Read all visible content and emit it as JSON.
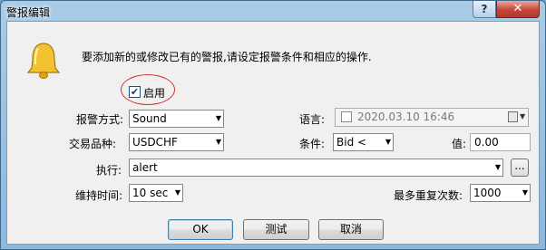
{
  "window": {
    "title": "警报编辑",
    "help_label": "?",
    "close_label": "✕"
  },
  "icons": {
    "bell": "bell-icon",
    "help": "question-mark",
    "close": "x-mark",
    "calendar": "calendar-icon",
    "dropdown": "chevron-down"
  },
  "intro_text": "要添加新的或修改已有的警报,请设定报警条件和相应的操作.",
  "enable": {
    "label": "启用",
    "checked": true,
    "mark": "✔"
  },
  "form": {
    "alert_method": {
      "label": "报警方式:",
      "value": "Sound"
    },
    "language": {
      "label": "语言:",
      "value": "2020.03.10 16:46"
    },
    "symbol": {
      "label": "交易品种:",
      "value": "USDCHF"
    },
    "condition": {
      "label": "条件:",
      "value": "Bid <"
    },
    "value": {
      "label": "值:",
      "value": "0.00"
    },
    "execute": {
      "label": "执行:",
      "value": "alert",
      "browse_label": "..."
    },
    "duration": {
      "label": "维持时间:",
      "value": "10 sec"
    },
    "max_repeats": {
      "label": "最多重复次数:",
      "value": "1000"
    }
  },
  "buttons": {
    "ok": "OK",
    "test": "测试",
    "cancel": "取消"
  },
  "colors": {
    "title_bar": "#a9cbe6",
    "close_button": "#c8453a",
    "dialog_bg": "#f0f0f0",
    "enable_highlight": "#d03030",
    "bell": "#f2c230"
  }
}
